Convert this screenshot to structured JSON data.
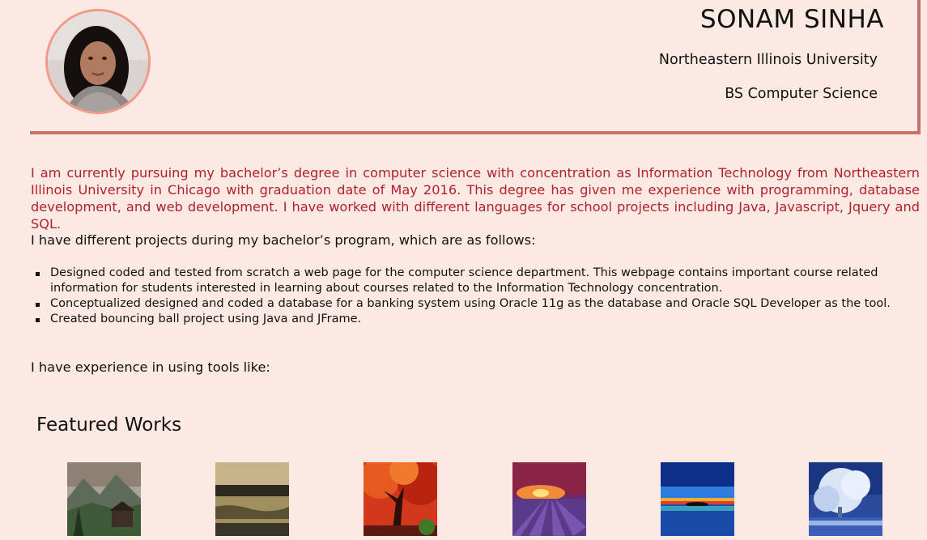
{
  "profile": {
    "name": "SONAM SINHA",
    "university": "Northeastern Illinois University",
    "degree": "BS Computer Science",
    "avatar_icon": "profile-photo"
  },
  "intro": "I am currently pursuing my bachelor’s degree in computer science with concentration as Information Technology from Northeastern Illinois University in Chicago with graduation date of May 2016. This degree has given me experience with programming, database development, and web development. I have worked with different languages for school projects including Java, Javascript, Jquery and SQL.",
  "projects": {
    "heading": "I have different projects during my bachelor’s program, which are as follows:",
    "items": [
      "Designed coded and tested from scratch a web page for the computer science department. This webpage contains important course related information for students interested in learning about courses related to the Information Technology concentration.",
      "Conceptualized designed and coded a database for a banking system using Oracle 11g as the database and Oracle SQL Developer as the tool.",
      "Created bouncing ball project using Java and JFrame."
    ]
  },
  "tools_heading": "I have experience in using tools like:",
  "featured": {
    "title": "Featured Works",
    "thumbnails": [
      "mountain-cabin-thumbnail",
      "lake-reflection-thumbnail",
      "autumn-tree-thumbnail",
      "lavender-sunset-thumbnail",
      "island-sunset-thumbnail",
      "snowy-tree-thumbnail"
    ]
  },
  "colors": {
    "background": "#fde9e3",
    "accent_border": "#c8706a",
    "intro_text": "#b0212e",
    "avatar_ring": "#f29a8a"
  }
}
